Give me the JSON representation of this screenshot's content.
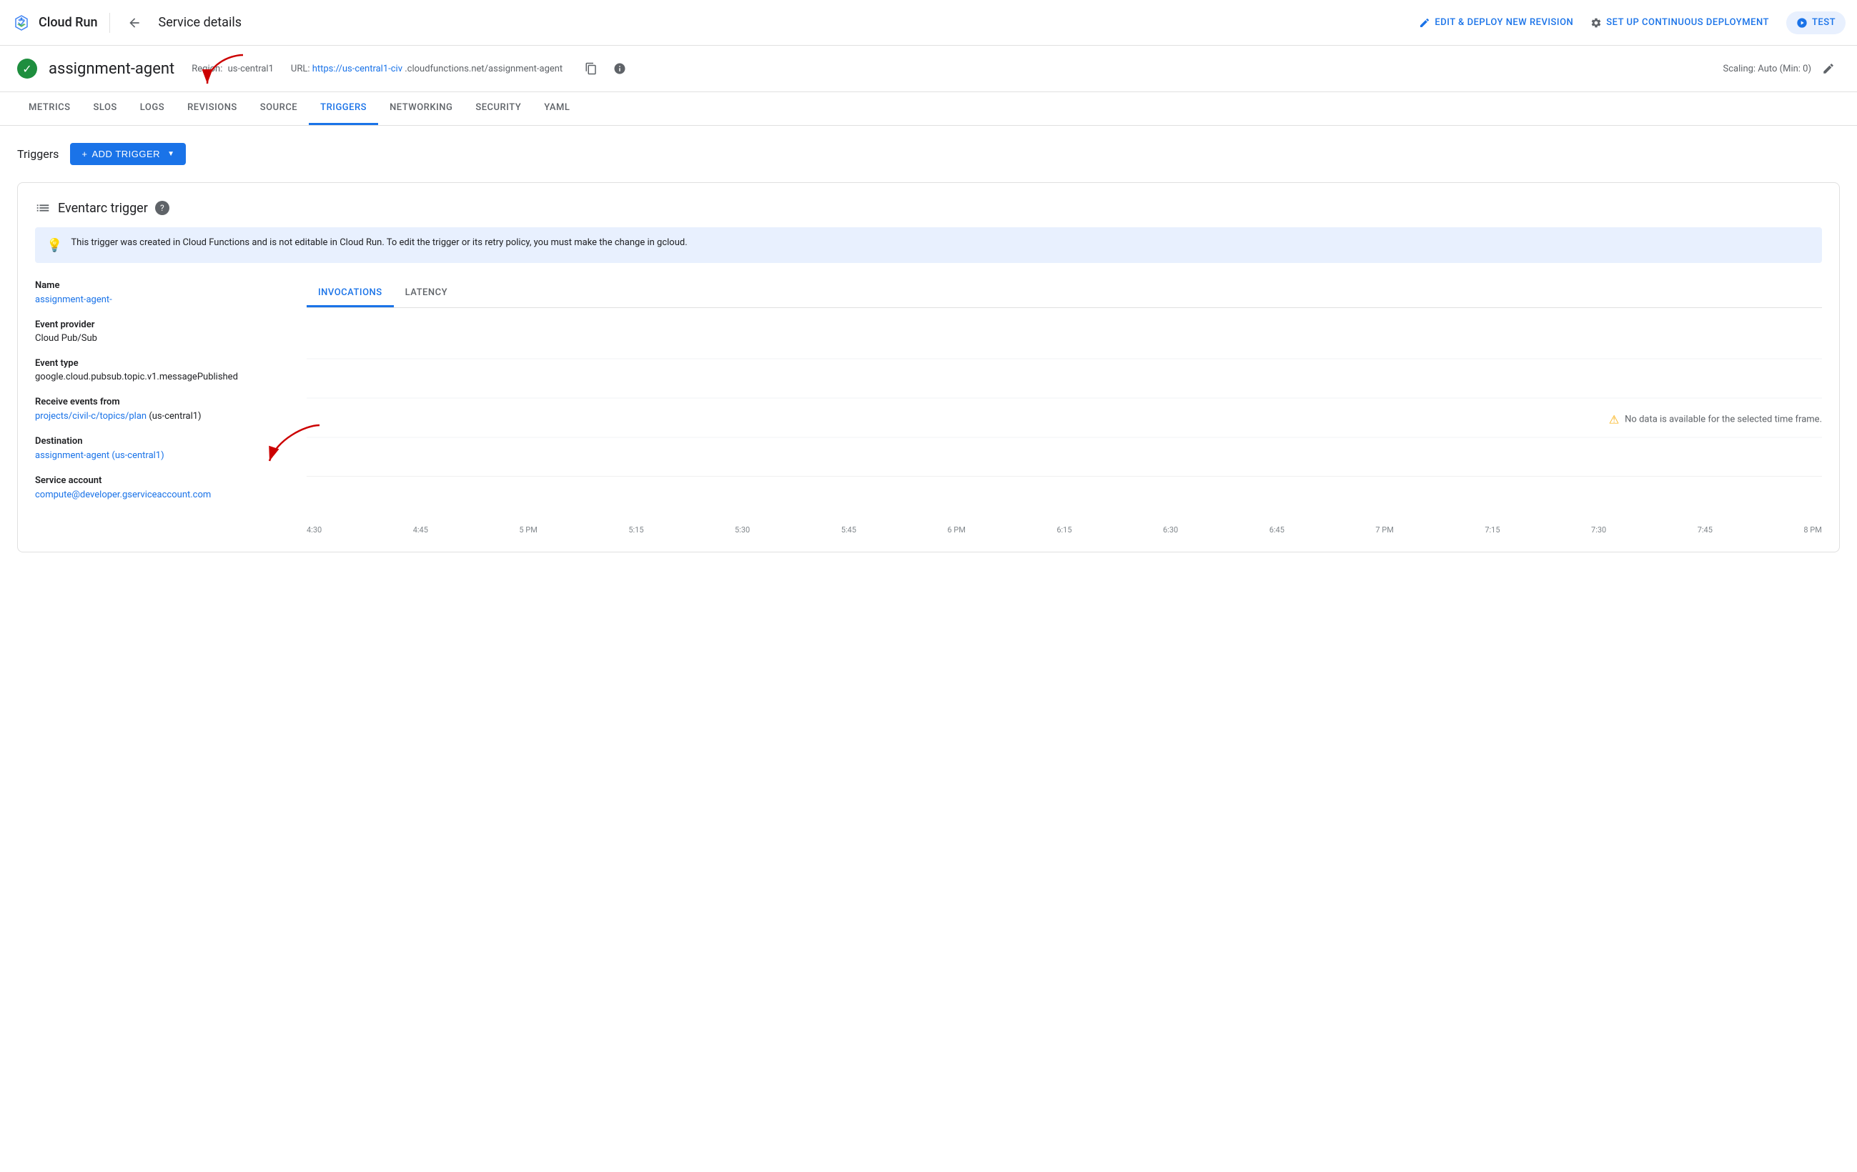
{
  "brand": {
    "logo_text": "Cloud Run"
  },
  "top_nav": {
    "back_label": "←",
    "page_title": "Service details",
    "actions": [
      {
        "key": "edit_deploy",
        "label": "EDIT & DEPLOY NEW REVISION",
        "icon": "pencil"
      },
      {
        "key": "continuous_deploy",
        "label": "SET UP CONTINUOUS DEPLOYMENT",
        "icon": "gear"
      },
      {
        "key": "test",
        "label": "TEST",
        "icon": "play"
      }
    ]
  },
  "service": {
    "name": "assignment-agent",
    "region_label": "Region:",
    "region_value": "us-central1",
    "url_label": "URL:",
    "url_display": "https://us-central1-civ",
    "url_suffix": ".cloudfunctions.net/assignment-agent",
    "scaling": "Scaling: Auto (Min: 0)"
  },
  "tabs": [
    {
      "key": "metrics",
      "label": "METRICS",
      "active": false
    },
    {
      "key": "slos",
      "label": "SLOS",
      "active": false
    },
    {
      "key": "logs",
      "label": "LOGS",
      "active": false
    },
    {
      "key": "revisions",
      "label": "REVISIONS",
      "active": false
    },
    {
      "key": "source",
      "label": "SOURCE",
      "active": false
    },
    {
      "key": "triggers",
      "label": "TRIGGERS",
      "active": true
    },
    {
      "key": "networking",
      "label": "NETWORKING",
      "active": false
    },
    {
      "key": "security",
      "label": "SECURITY",
      "active": false
    },
    {
      "key": "yaml",
      "label": "YAML",
      "active": false
    }
  ],
  "triggers_section": {
    "title": "Triggers",
    "add_button_label": "ADD TRIGGER"
  },
  "eventarc_trigger": {
    "title": "Eventarc trigger",
    "info_banner": "This trigger was created in Cloud Functions and is not editable in Cloud Run. To edit the trigger or its retry policy, you must make the change in gcloud.",
    "name_label": "Name",
    "name_value": "assignment-agent-",
    "event_provider_label": "Event provider",
    "event_provider_value": "Cloud Pub/Sub",
    "event_type_label": "Event type",
    "event_type_value": "google.cloud.pubsub.topic.v1.messagePublished",
    "receive_events_label": "Receive events from",
    "receive_events_value": "projects/civil-c",
    "receive_events_suffix": "/topics/plan",
    "receive_events_region": "(us-central1)",
    "destination_label": "Destination",
    "destination_value": "assignment-agent (us-central1)",
    "service_account_label": "Service account",
    "service_account_value": "compute@developer.gserviceaccount.com"
  },
  "chart": {
    "tabs": [
      {
        "key": "invocations",
        "label": "INVOCATIONS",
        "active": true
      },
      {
        "key": "latency",
        "label": "LATENCY",
        "active": false
      }
    ],
    "no_data_message": "No data is available for the selected time frame.",
    "x_axis_labels": [
      "4:30",
      "4:45",
      "5 PM",
      "5:15",
      "5:30",
      "5:45",
      "6 PM",
      "6:15",
      "6:30",
      "6:45",
      "7 PM",
      "7:15",
      "7:30",
      "7:45",
      "8 PM"
    ]
  }
}
